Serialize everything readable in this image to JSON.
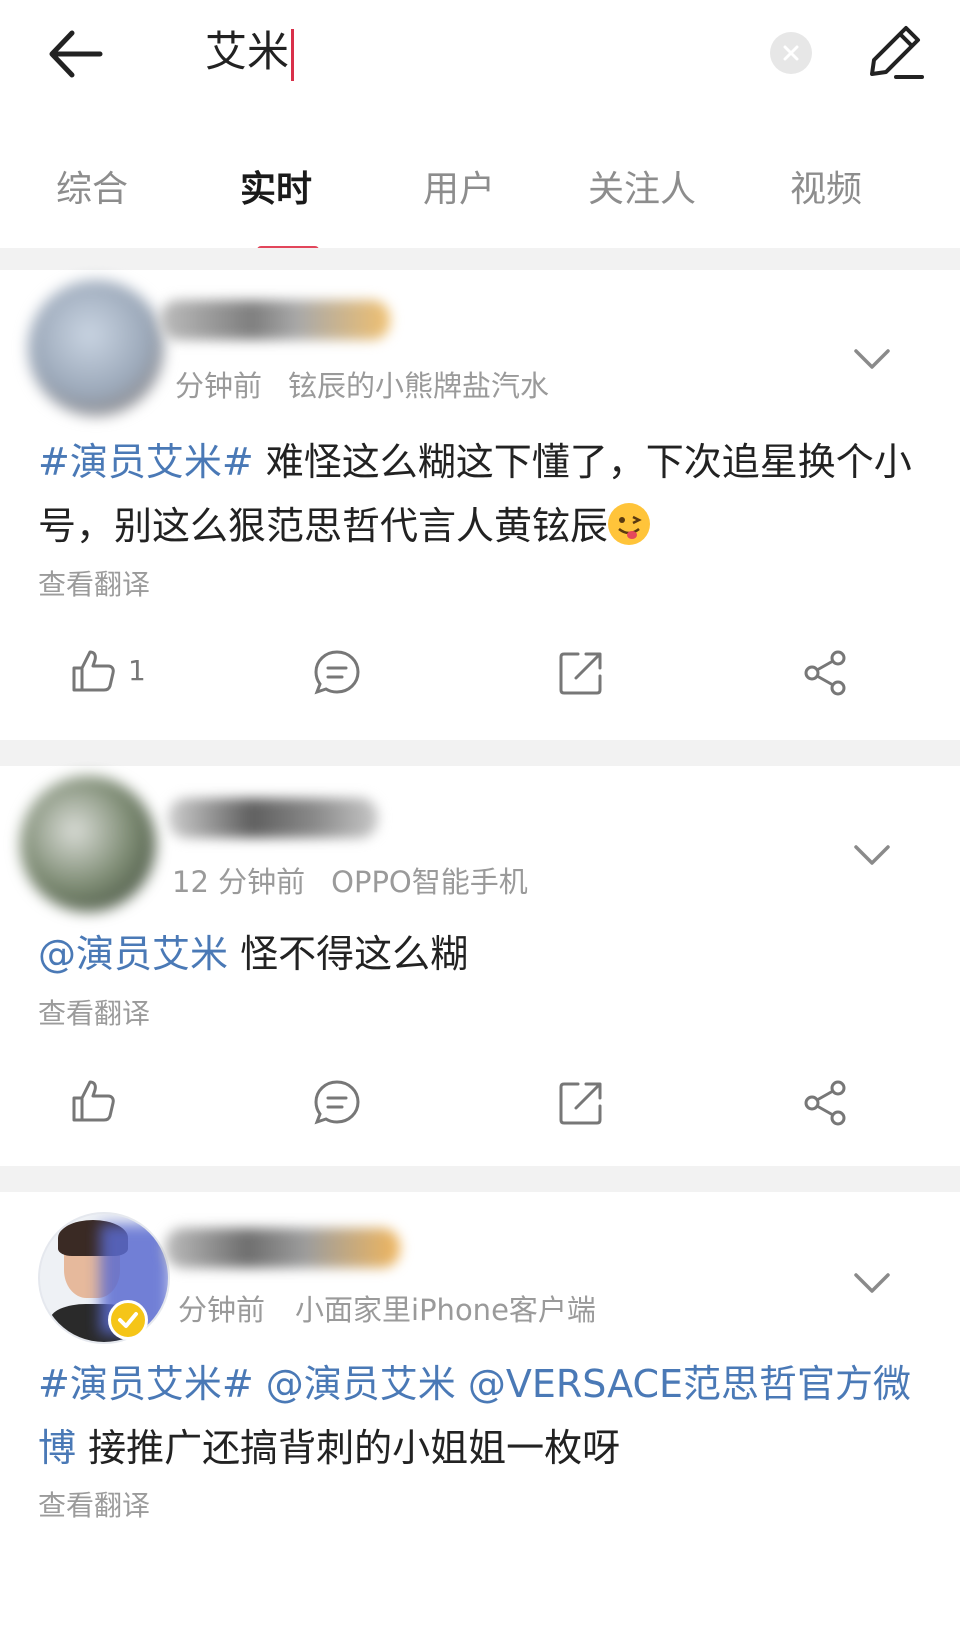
{
  "search": {
    "query": "艾米"
  },
  "tabs": [
    {
      "label": "综合"
    },
    {
      "label": "实时",
      "active": true
    },
    {
      "label": "用户"
    },
    {
      "label": "关注人"
    },
    {
      "label": "视频"
    }
  ],
  "posts": [
    {
      "time": "分钟前",
      "source": "铉辰的小熊牌盐汽水",
      "topic": "#演员艾米#",
      "text": "难怪这么糊这下懂了，下次追星换个小号，别这么狠范思哲代言人黄铉辰",
      "emoji": "face-winking-tongue",
      "translate": "查看翻译",
      "likes": "1"
    },
    {
      "time": "12 分钟前",
      "source": "OPPO智能手机",
      "mention": "@演员艾米",
      "text": "怪不得这么糊",
      "translate": "查看翻译"
    },
    {
      "time": "分钟前",
      "source": "小面家里iPhone客户端",
      "topic": "#演员艾米#",
      "mention1": "@演员艾米",
      "mention2": "@VERSACE范思哲官方微博",
      "text": "接推广还搞背刺的小姐姐一枚呀",
      "translate": "查看翻译"
    }
  ],
  "colors": {
    "accent": "#e2465b",
    "link": "#4a79b6",
    "caret": "#d9304a"
  }
}
